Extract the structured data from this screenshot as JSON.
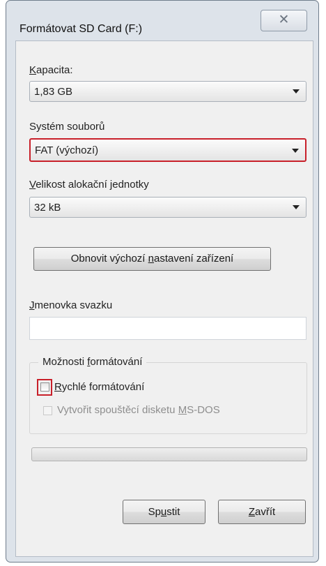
{
  "window": {
    "title": "Formátovat SD Card (F:)",
    "close_glyph": "✕"
  },
  "capacity": {
    "label_key": "K",
    "label_rest": "apacita:",
    "value": "1,83 GB"
  },
  "filesystem": {
    "label": "Systém souborů",
    "value": "FAT (výchozí)",
    "highlight_color": "#c8202a"
  },
  "allocation": {
    "label_key": "V",
    "label_rest": "elikost alokační jednotky",
    "value": "32 kB"
  },
  "restore_defaults": {
    "label_pre": "Obnovit výchozí ",
    "label_key": "n",
    "label_post": "astavení zařízení"
  },
  "volume_label": {
    "label_key": "J",
    "label_rest": "menovka svazku",
    "value": ""
  },
  "format_options": {
    "title_pre": "Možnosti ",
    "title_key": "f",
    "title_post": "ormátování",
    "quick_format": {
      "label_key": "R",
      "label_rest": "ychlé formátování",
      "checked": false
    },
    "msdos_boot": {
      "label_pre": "Vytvořit spouštěcí disketu ",
      "label_key": "M",
      "label_post": "S-DOS",
      "checked": false,
      "disabled": true
    }
  },
  "buttons": {
    "start_pre": "Sp",
    "start_key": "u",
    "start_post": "stit",
    "close_key": "Z",
    "close_rest": "avřít"
  }
}
